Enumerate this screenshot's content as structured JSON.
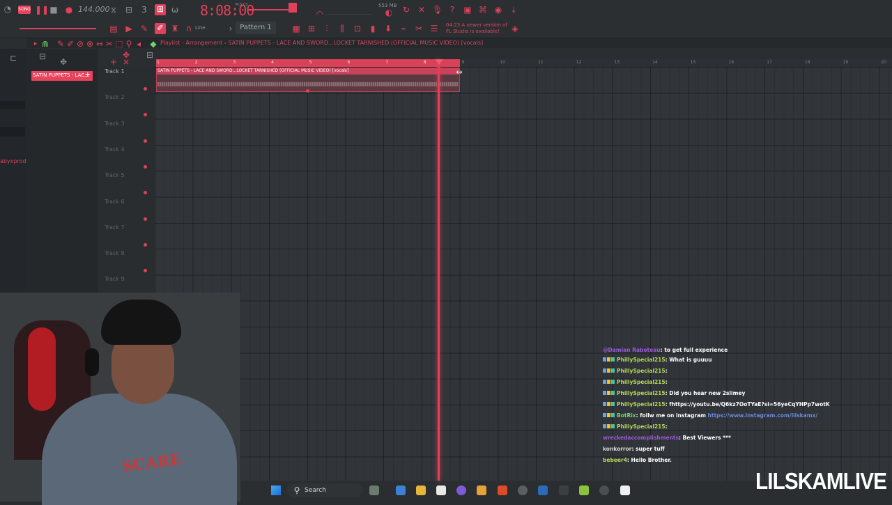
{
  "toolbar": {
    "song_mode": "SONG",
    "tempo": "144.000",
    "time": "8:08:00",
    "time_label": "M:S:CS",
    "memory": "553 MB",
    "pattern": "Pattern 1",
    "snap": "Line",
    "news_time": "04:23",
    "news": "A newer version of FL Studio is available!"
  },
  "playlist": {
    "title": "Playlist - Arrangement",
    "separator": "›",
    "song": "SATIN PUPPETS - LACE AND SWORD...LOCKET TARNISHED (OFFICIAL MUSIC VIDEO) [vocals]",
    "clip_chip": "SATIN PUPPETS - LAC...",
    "clip_label": "SATIN PUPPETS - LACE AND SWORD...LOCKET TARNISHED (OFFICIAL MUSIC VIDEO) [vocals]",
    "ruler": [
      "1",
      "2",
      "3",
      "4",
      "5",
      "6",
      "7",
      "8",
      "9",
      "10",
      "11",
      "12",
      "13",
      "14",
      "15",
      "16",
      "17",
      "18",
      "19",
      "20"
    ],
    "tracks": [
      "Track 1",
      "Track 2",
      "Track 3",
      "Track 4",
      "Track 5",
      "Track 6",
      "Track 7",
      "Track 8",
      "Track 9"
    ]
  },
  "sidebar_user": "abyxprod",
  "chat": [
    {
      "user": "@Damian Raboteau",
      "text": ": to get full experience",
      "cls": "u-purple"
    },
    {
      "user": "PhillySpecial215",
      "text": ": What is guuuu",
      "cls": "u-philly"
    },
    {
      "user": "PhillySpecial215",
      "text": ":",
      "cls": "u-philly"
    },
    {
      "user": "PhillySpecial215",
      "text": ":",
      "cls": "u-philly"
    },
    {
      "user": "PhillySpecial215",
      "text": ": Did you hear new 2slimey",
      "cls": "u-philly"
    },
    {
      "user": "PhillySpecial215",
      "text": ": fhttps://youtu.be/Q6kz7OoTYaE?si=56yeCqYHPp7wotK",
      "cls": "u-philly"
    },
    {
      "user": "BotRix",
      "text": ": follw me on instagram ",
      "link": "https://www.instagram.com/lilskamx/",
      "cls": "u-botrix"
    },
    {
      "user": "PhillySpecial215",
      "text": ":",
      "cls": "u-philly"
    },
    {
      "user": "wreckedaccomplishments",
      "text": ": Best Viewers ***",
      "cls": "u-purple"
    },
    {
      "user": "konkorror",
      "text": ": super tuff",
      "cls": "u-konk"
    },
    {
      "user": "bebeer4",
      "text": ": Hello Brother.",
      "cls": "u-philly"
    }
  ],
  "webcam": {
    "hoodie_text": "SCARE"
  },
  "taskbar": {
    "search": "Search"
  },
  "watermark": "LILSKAMLIVE",
  "colors": {
    "accent": "#e0405a",
    "panel": "#2b2f32",
    "grid": "#31353a"
  }
}
